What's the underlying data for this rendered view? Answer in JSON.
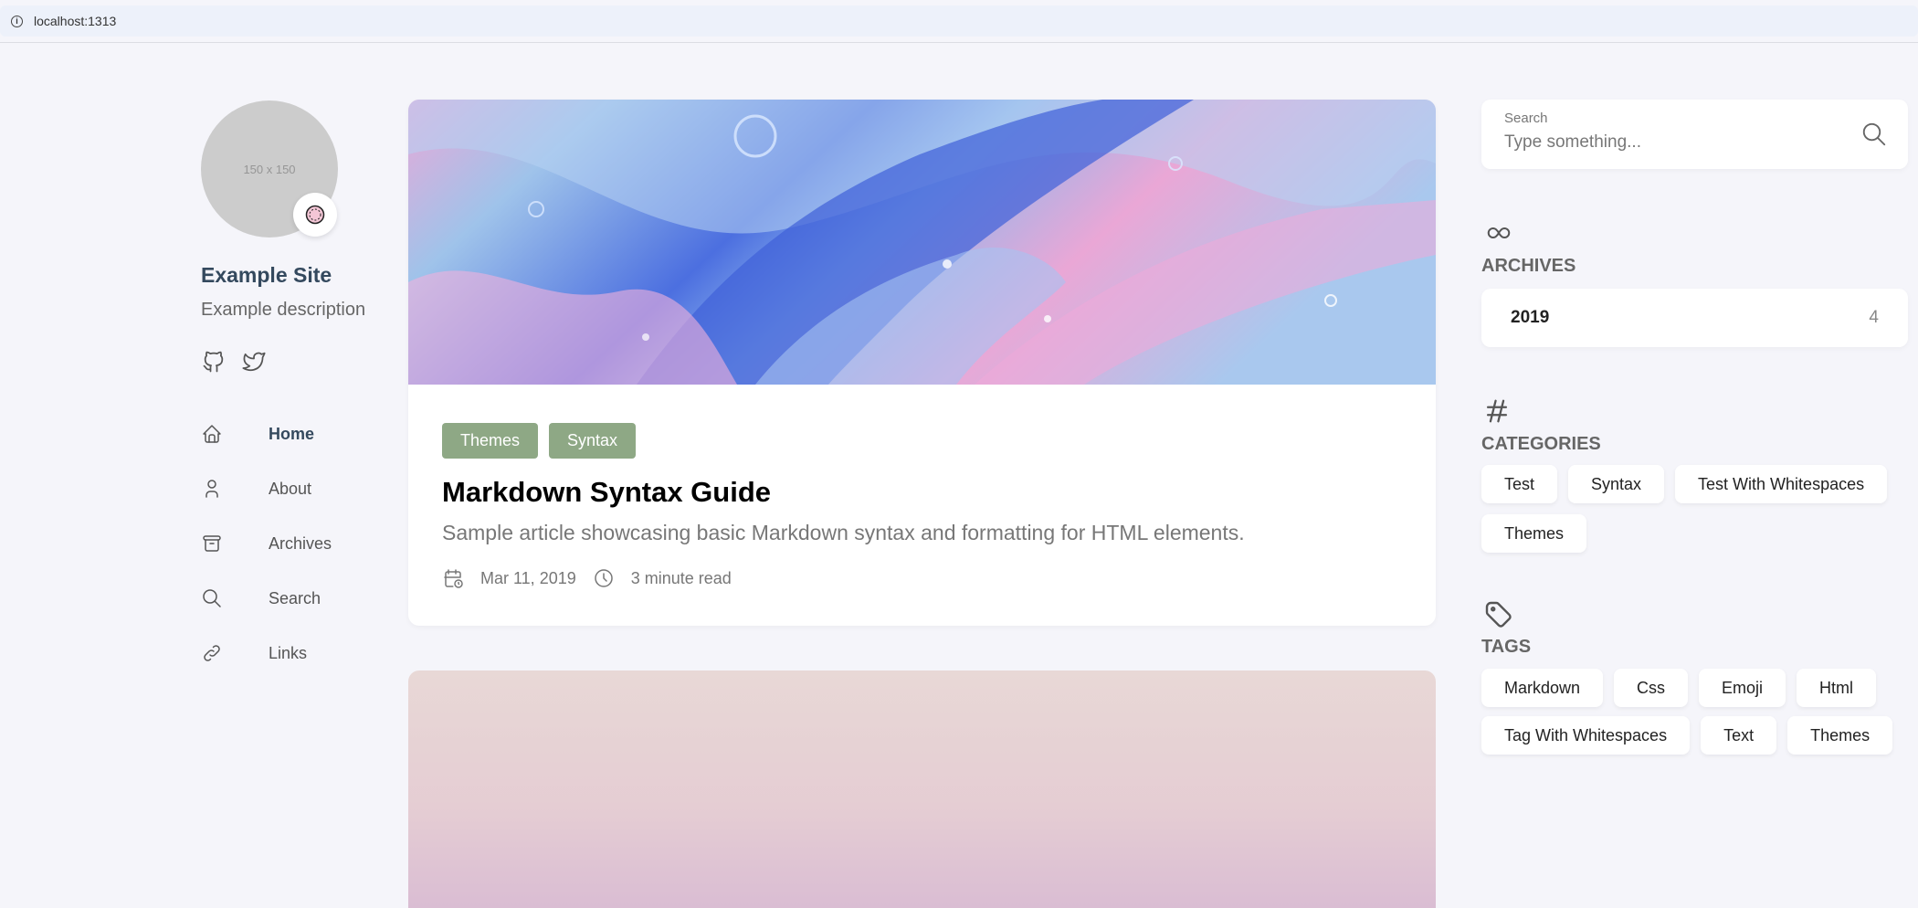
{
  "browser": {
    "url": "localhost:1313"
  },
  "profile": {
    "avatar_placeholder": "150 x 150",
    "site_name": "Example Site",
    "site_description": "Example description",
    "social": [
      {
        "icon": "github-icon"
      },
      {
        "icon": "twitter-icon"
      }
    ]
  },
  "menu": {
    "items": [
      {
        "label": "Home",
        "icon": "home-icon",
        "active": true
      },
      {
        "label": "About",
        "icon": "user-icon",
        "active": false
      },
      {
        "label": "Archives",
        "icon": "archive-icon",
        "active": false
      },
      {
        "label": "Search",
        "icon": "search-icon",
        "active": false
      },
      {
        "label": "Links",
        "icon": "link-icon",
        "active": false
      }
    ]
  },
  "article": {
    "categories": [
      "Themes",
      "Syntax"
    ],
    "title": "Markdown Syntax Guide",
    "description": "Sample article showcasing basic Markdown syntax and formatting for HTML elements.",
    "date": "Mar 11, 2019",
    "read_time": "3 minute read"
  },
  "search": {
    "label": "Search",
    "placeholder": "Type something..."
  },
  "archives": {
    "title": "ARCHIVES",
    "items": [
      {
        "year": "2019",
        "count": "4"
      }
    ]
  },
  "categories_widget": {
    "title": "CATEGORIES",
    "items": [
      "Test",
      "Syntax",
      "Test With Whitespaces",
      "Themes"
    ]
  },
  "tags_widget": {
    "title": "TAGS",
    "items": [
      "Markdown",
      "Css",
      "Emoji",
      "Html",
      "Tag With Whitespaces",
      "Text",
      "Themes"
    ]
  },
  "colors": {
    "page_background": "#f5f5fa",
    "category_tag": "#8ea885",
    "accent_text": "#34495e"
  }
}
